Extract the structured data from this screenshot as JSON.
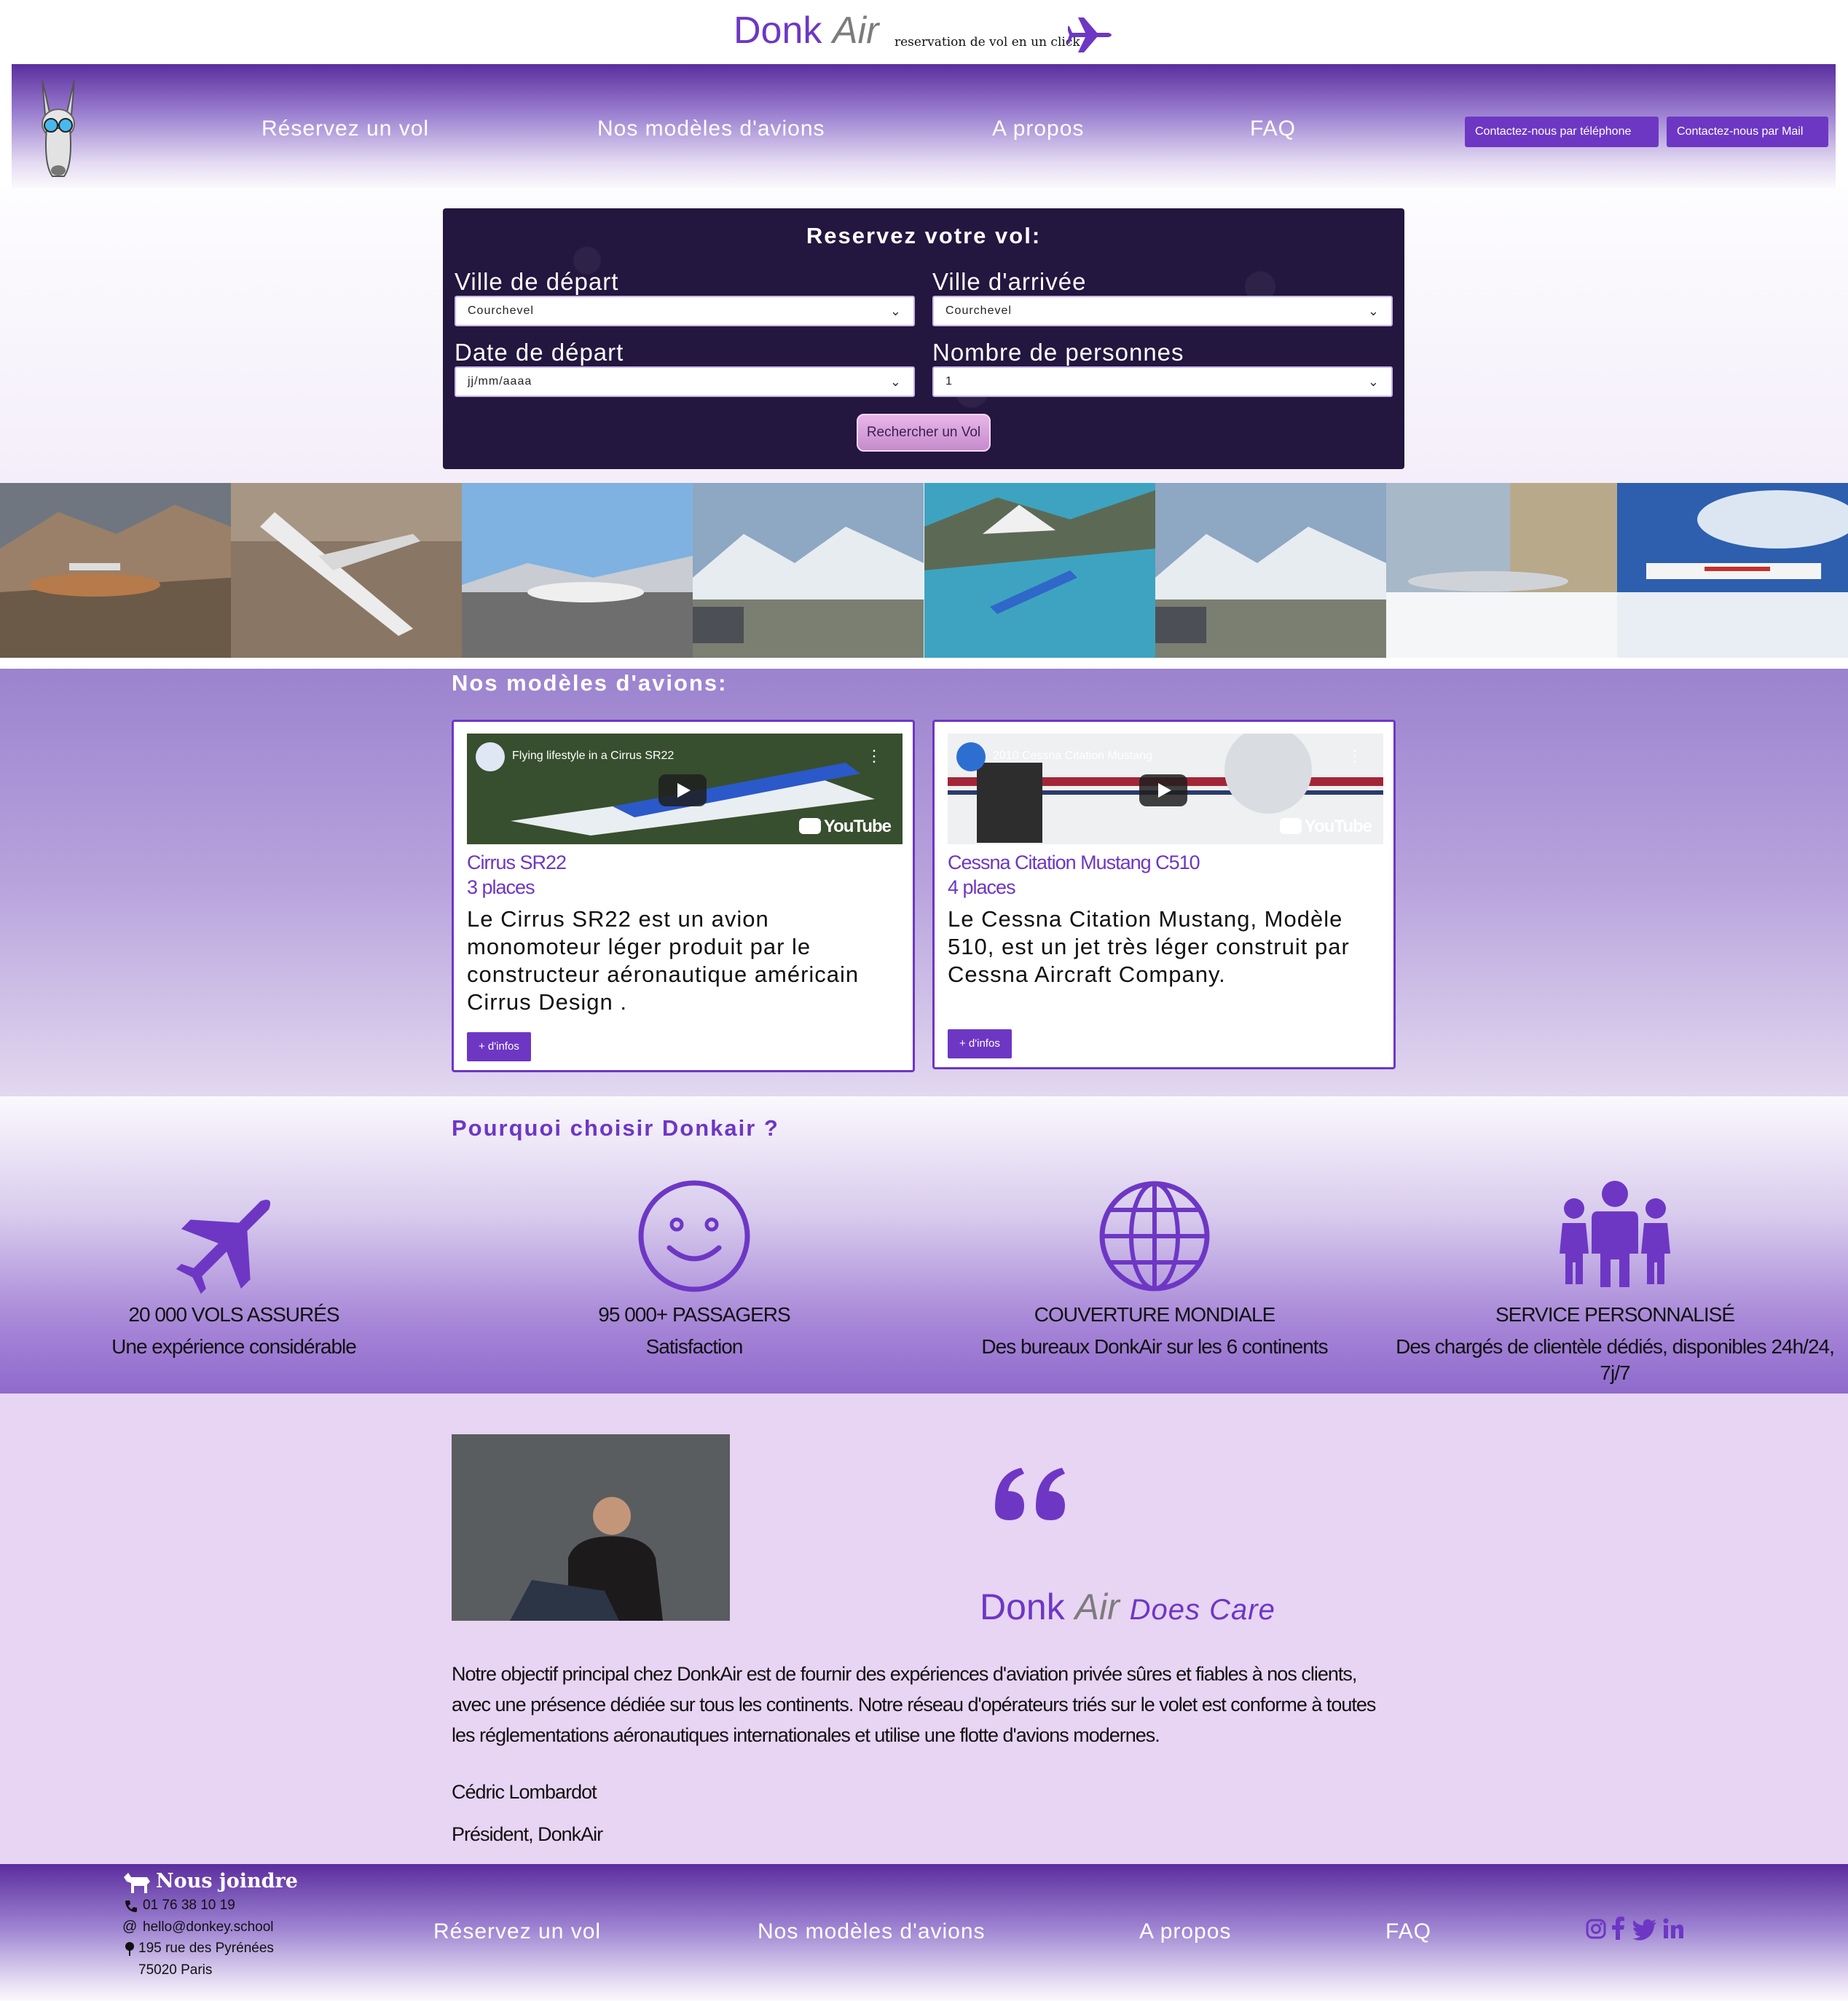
{
  "brand": {
    "name_part1": "Donk",
    "name_part2": "Air",
    "tagline": "reservation de vol en un click",
    "icon": "plane-icon"
  },
  "nav": {
    "logo_icon": "donkey-logo",
    "items": [
      "Réservez un vol",
      "Nos modèles d'avions",
      "A propos",
      "FAQ"
    ],
    "contact_phone": "Contactez-nous par téléphone",
    "contact_mail": "Contactez-nous par Mail"
  },
  "booking": {
    "title": "Reservez votre vol:",
    "depart_label": "Ville de départ",
    "depart_value": "Courchevel",
    "arrive_label": "Ville d'arrivée",
    "arrive_value": "Courchevel",
    "date_label": "Date de départ",
    "date_value": "jj/mm/aaaa",
    "persons_label": "Nombre de personnes",
    "persons_value": "1",
    "search_button": "Rechercher un Vol"
  },
  "models": {
    "title": "Nos modèles d'avions:",
    "cards": [
      {
        "video_title": "Flying lifestyle in a Cirrus SR22",
        "name": "Cirrus SR22",
        "seats": "3 places",
        "description": "Le Cirrus SR22 est un avion monomoteur léger produit par le constructeur aéronautique américain Cirrus Design .",
        "button": "+ d'infos"
      },
      {
        "video_title": "2010 Cessna Citation Mustang",
        "name": "Cessna Citation Mustang C510",
        "seats": "4 places",
        "description": "Le Cessna Citation Mustang, Modèle 510, est un jet très léger construit par Cessna Aircraft Company.",
        "button": "+ d'infos"
      }
    ],
    "youtube_label": "YouTube"
  },
  "why": {
    "title": "Pourquoi choisir Donkair ?",
    "features": [
      {
        "icon": "plane-icon",
        "title": "20 000 VOLS ASSURÉS",
        "subtitle": "Une expérience considérable"
      },
      {
        "icon": "smiley-icon",
        "title": "95 000+ PASSAGERS",
        "subtitle": "Satisfaction"
      },
      {
        "icon": "globe-icon",
        "title": "COUVERTURE MONDIALE",
        "subtitle": "Des bureaux DonkAir sur les 6 continents"
      },
      {
        "icon": "people-icon",
        "title": "SERVICE PERSONNALISÉ",
        "subtitle": "Des chargés de clientèle dédiés, disponibles 24h/24, 7j/7"
      }
    ]
  },
  "quote": {
    "brand_part1": "Donk",
    "brand_part2": "Air",
    "brand_part3": "Does Care",
    "text": "Notre objectif principal chez DonkAir est de fournir des expériences d'aviation privée sûres et fiables à nos clients, avec une présence dédiée sur tous les continents. Notre réseau d'opérateurs triés sur le volet est conforme à toutes les réglementations aéronautiques internationales et utilise une flotte d'avions modernes.",
    "name": "Cédric Lombardot",
    "role": "Président, DonkAir"
  },
  "footer": {
    "title": "Nous joindre",
    "phone": "01 76 38 10 19",
    "email": "hello@donkey.school",
    "address_line1": "195 rue des Pyrénées",
    "address_line2": "75020 Paris",
    "nav": [
      "Réservez un vol",
      "Nos modèles d'avions",
      "A propos",
      "FAQ"
    ],
    "social": [
      "instagram-icon",
      "facebook-icon",
      "twitter-icon",
      "linkedin-icon"
    ]
  },
  "colors": {
    "accent": "#6d37c4",
    "booking_bg": "#23163f",
    "quote_bg": "#e8d4f3"
  }
}
